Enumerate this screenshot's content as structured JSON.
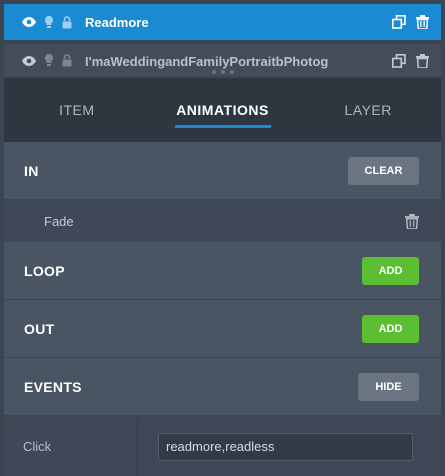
{
  "layers": [
    {
      "name": "Readmore",
      "active": true
    },
    {
      "name": "I'maWeddingandFamilyPortraitbPhotog",
      "active": false
    }
  ],
  "tabs": [
    {
      "label": "ITEM",
      "active": false
    },
    {
      "label": "ANIMATIONS",
      "active": true
    },
    {
      "label": "LAYER",
      "active": false
    }
  ],
  "sections": {
    "in": {
      "title": "IN",
      "button": "CLEAR"
    },
    "fade": {
      "label": "Fade"
    },
    "loop": {
      "title": "LOOP",
      "button": "ADD"
    },
    "out": {
      "title": "OUT",
      "button": "ADD"
    },
    "events": {
      "title": "EVENTS",
      "button": "HIDE"
    }
  },
  "click_event": {
    "label": "Click",
    "value": "readmore,readless"
  },
  "icons": [
    "eye-icon",
    "lightbulb-icon",
    "lock-icon",
    "duplicate-icon",
    "trash-icon"
  ],
  "colors": {
    "accent": "#1a8ad2",
    "green": "#5cbe32",
    "panel": "#4a5564",
    "dark": "#2e3640"
  }
}
